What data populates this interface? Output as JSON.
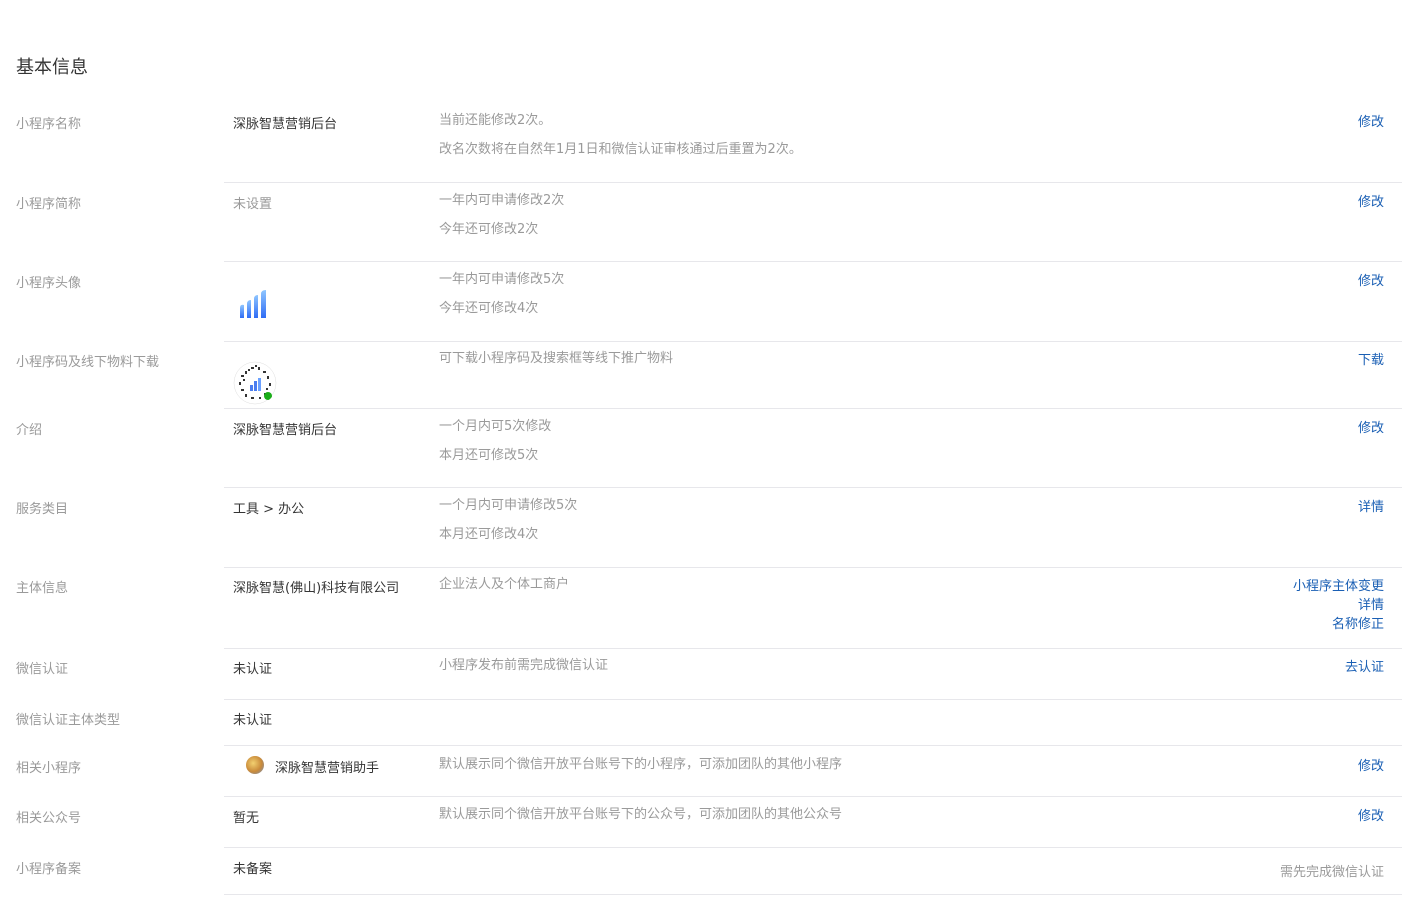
{
  "page_title": "基本信息",
  "rows": [
    {
      "label": "小程序名称",
      "value": "深脉智慧营销后台",
      "desc1": "当前还能修改2次。",
      "desc2": "改名次数将在自然年1月1日和微信认证审核通过后重置为2次。",
      "action": "修改"
    },
    {
      "label": "小程序简称",
      "value": "未设置",
      "desc1": "一年内可申请修改2次",
      "desc2": "今年还可修改2次",
      "action": "修改"
    },
    {
      "label": "小程序头像",
      "desc1": "一年内可申请修改5次",
      "desc2": "今年还可修改4次",
      "action": "修改"
    },
    {
      "label": "小程序码及线下物料下载",
      "desc1": "可下载小程序码及搜索框等线下推广物料",
      "action": "下载"
    },
    {
      "label": "介绍",
      "value": "深脉智慧营销后台",
      "desc1": "一个月内可5次修改",
      "desc2": "本月还可修改5次",
      "action": "修改"
    },
    {
      "label": "服务类目",
      "value": "工具 > 办公",
      "desc1": "一个月内可申请修改5次",
      "desc2": "本月还可修改4次",
      "action": "详情"
    },
    {
      "label": "主体信息",
      "value": "深脉智慧(佛山)科技有限公司",
      "desc1": "企业法人及个体工商户",
      "actions": [
        "小程序主体变更",
        "详情",
        "名称修正"
      ]
    },
    {
      "label": "微信认证",
      "value": "未认证",
      "desc1": "小程序发布前需完成微信认证",
      "action": "去认证"
    },
    {
      "label": "微信认证主体类型",
      "value": "未认证"
    },
    {
      "label": "相关小程序",
      "value": "深脉智慧营销助手",
      "desc1": "默认展示同个微信开放平台账号下的小程序，可添加团队的其他小程序",
      "action": "修改"
    },
    {
      "label": "相关公众号",
      "value": "暂无",
      "desc1": "默认展示同个微信开放平台账号下的公众号，可添加团队的其他公众号",
      "action": "修改"
    },
    {
      "label": "小程序备案",
      "value": "未备案",
      "action_gray": "需先完成微信认证"
    }
  ],
  "colors": {
    "link": "#1a5fb4",
    "label": "#9a9a9a",
    "text": "#353535",
    "border": "#e7e7eb"
  }
}
